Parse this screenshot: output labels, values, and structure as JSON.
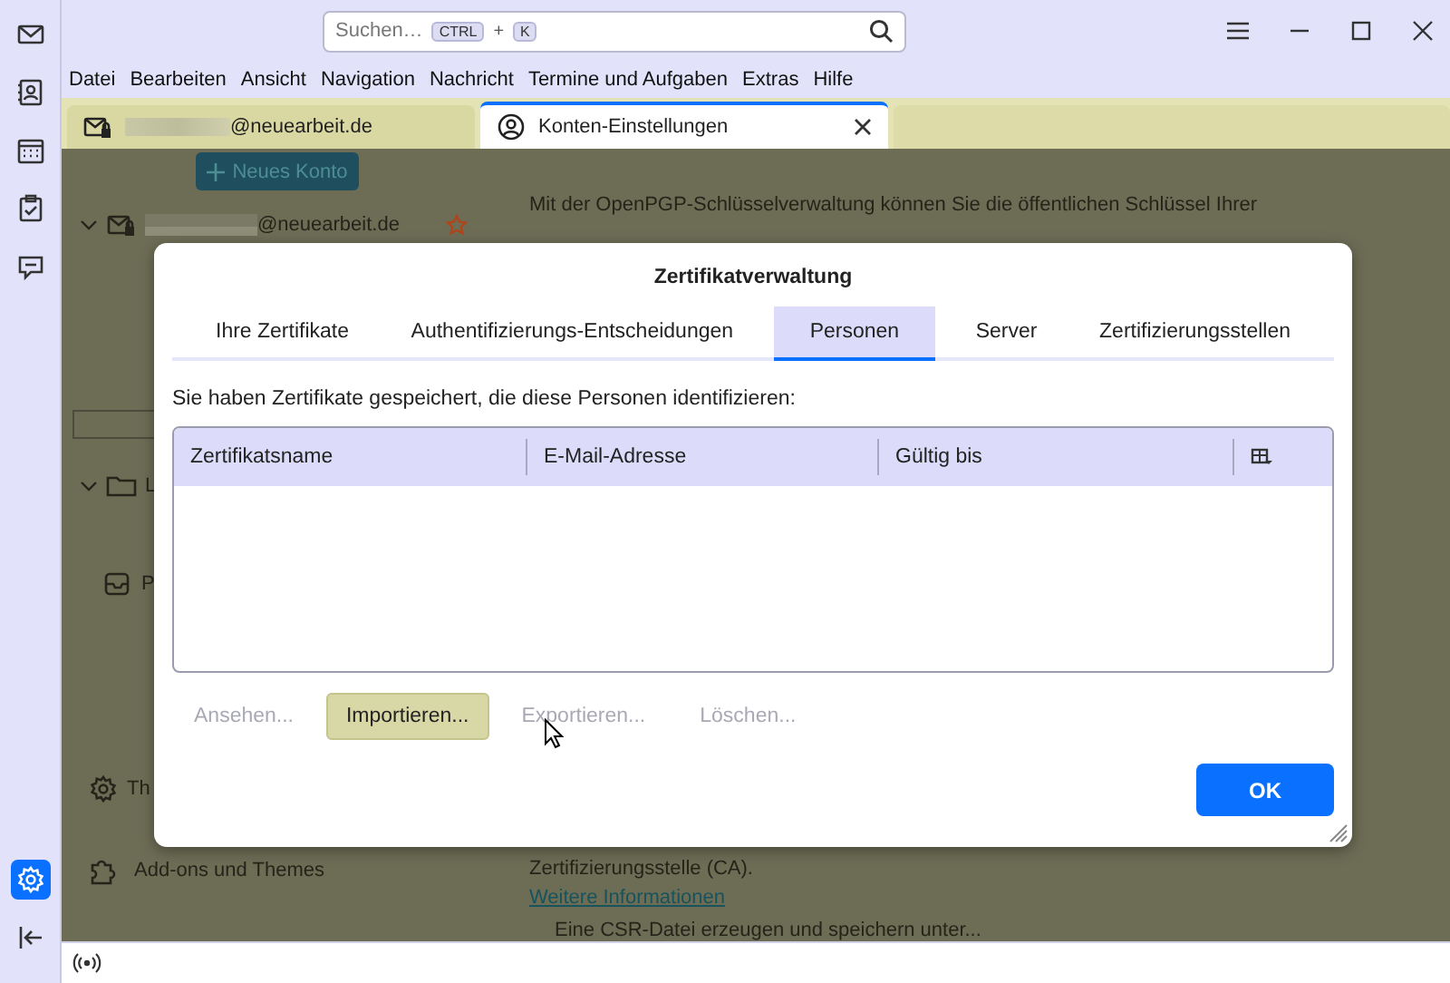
{
  "search": {
    "placeholder": "Suchen…",
    "keys": [
      "CTRL",
      "+",
      "K"
    ]
  },
  "menubar": [
    "Datei",
    "Bearbeiten",
    "Ansicht",
    "Navigation",
    "Nachricht",
    "Termine und Aufgaben",
    "Extras",
    "Hilfe"
  ],
  "spaces": [
    {
      "kind": "mail",
      "selected": false
    },
    {
      "kind": "contacts",
      "selected": false
    },
    {
      "kind": "calendar",
      "selected": false
    },
    {
      "kind": "tasks",
      "selected": false
    },
    {
      "kind": "chat",
      "selected": false
    }
  ],
  "spaces_bottom": [
    {
      "kind": "settings",
      "selected": true
    },
    {
      "kind": "collapse",
      "selected": false
    }
  ],
  "tabs": [
    {
      "label": "@neuearbeit.de",
      "redacted": true,
      "kind": "mail",
      "selected": false
    },
    {
      "label": "Konten-Einstellungen",
      "redacted": false,
      "kind": "account",
      "selected": true
    }
  ],
  "account_pane": {
    "new_account": "Neues Konto",
    "account": "@neuearbeit.de",
    "folder": "L",
    "item": "P",
    "settings": "Th",
    "addons": "Add-ons und Themes"
  },
  "settings_pane": {
    "intro": "Mit der OpenPGP-Schlüsselverwaltung können Sie die öffentlichen Schlüssel Ihrer",
    "ca": "Zertifizierungsstelle (CA).",
    "link": "Weitere Informationen",
    "csr": "Eine CSR-Datei erzeugen und speichern unter..."
  },
  "dialog": {
    "title": "Zertifikatverwaltung",
    "tabs": [
      {
        "label": "Ihre Zertifikate",
        "selected": false
      },
      {
        "label": "Authentifizierungs-Entscheidungen",
        "selected": false
      },
      {
        "label": "Personen",
        "selected": true
      },
      {
        "label": "Server",
        "selected": false
      },
      {
        "label": "Zertifizierungsstellen",
        "selected": false
      }
    ],
    "description": "Sie haben Zertifikate gespeichert, die diese Personen identifizieren:",
    "table": {
      "columns": [
        "Zertifikatsname",
        "E-Mail-Adresse",
        "Gültig bis"
      ]
    },
    "buttons": [
      {
        "label": "Ansehen...",
        "disabled": true,
        "hovered": false
      },
      {
        "label": "Importieren...",
        "disabled": false,
        "hovered": true
      },
      {
        "label": "Exportieren...",
        "disabled": true,
        "hovered": false
      },
      {
        "label": "Löschen...",
        "disabled": true,
        "hovered": false
      }
    ],
    "ok": "OK"
  }
}
